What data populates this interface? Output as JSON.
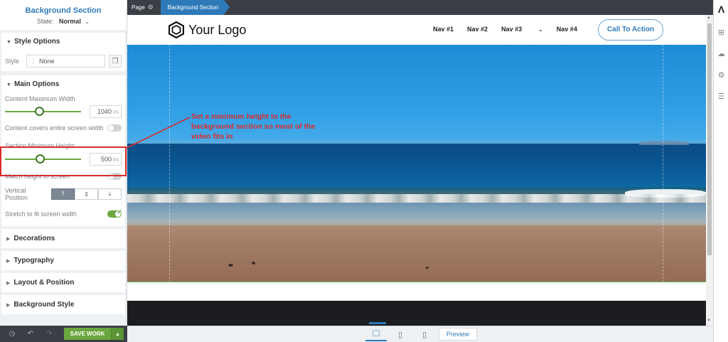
{
  "panel": {
    "title": "Background Section",
    "state_label": "State:",
    "state_value": "Normal",
    "style_options": {
      "heading": "Style Options",
      "style_label": "Style",
      "style_value": "None"
    },
    "main_options": {
      "heading": "Main Options",
      "content_max_width_label": "Content Maximum Width",
      "content_max_width_value": "1040",
      "content_max_width_unit": "PX",
      "content_max_width_level": 0.45,
      "content_covers_label": "Content covers entire screen width",
      "content_covers_on": false,
      "section_min_height_label": "Section Minimum Height",
      "section_min_height_value": "500",
      "section_min_height_unit": "PX",
      "section_min_height_level": 0.46,
      "match_height_label": "Match height to screen",
      "match_height_on": false,
      "vertical_position_label": "Vertical Position",
      "vertical_position_options": [
        "⤒",
        "⇕",
        "⤓"
      ],
      "stretch_label": "Stretch to fit screen width",
      "stretch_on": true
    },
    "collapsed_sections": [
      "Decorations",
      "Typography",
      "Layout & Position",
      "Background Style"
    ]
  },
  "bottom_bar": {
    "save_label": "SAVE WORK"
  },
  "breadcrumb": {
    "page_label": "Page",
    "current": "Background Section"
  },
  "site": {
    "logo_text": "Your Logo",
    "nav": [
      "Nav #1",
      "Nav #2",
      "Nav #3",
      "Nav #4"
    ],
    "cta_label": "Call To Action"
  },
  "callout_text": "Set a minimum height to the background section so most of the video fits in",
  "device_bar": {
    "preview_label": "Preview"
  },
  "colors": {
    "accent_blue": "#2e7ab8",
    "save_green": "#6aa73f",
    "highlight_red": "#d92c2c",
    "dark_bar": "#3a3f45"
  }
}
